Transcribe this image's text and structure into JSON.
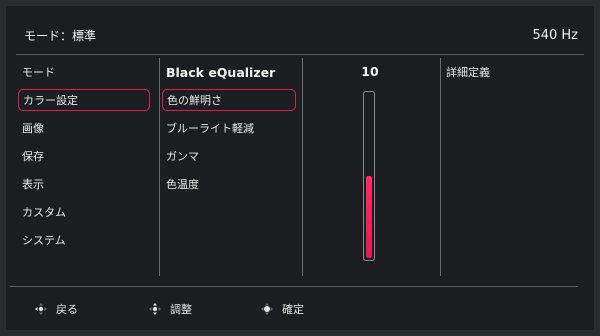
{
  "header": {
    "mode": "モード：標準",
    "refresh_rate": "540 Hz"
  },
  "menu": {
    "items": [
      {
        "label": "モード",
        "selected": false
      },
      {
        "label": "カラー設定",
        "selected": true
      },
      {
        "label": "画像",
        "selected": false
      },
      {
        "label": "保存",
        "selected": false
      },
      {
        "label": "表示",
        "selected": false
      },
      {
        "label": "カスタム",
        "selected": false
      },
      {
        "label": "システム",
        "selected": false
      }
    ]
  },
  "submenu": {
    "title": "Black eQualizer",
    "items": [
      {
        "label": "色の鮮明さ",
        "selected": true
      },
      {
        "label": "ブルーライト軽減",
        "selected": false
      },
      {
        "label": "ガンマ",
        "selected": false
      },
      {
        "label": "色温度",
        "selected": false
      }
    ]
  },
  "adjust": {
    "value": "10",
    "level_fraction": 0.5
  },
  "detail": {
    "label": "詳細定義"
  },
  "footer": {
    "back_label": "戻る",
    "adjust_label": "調整",
    "confirm_label": "確定"
  },
  "colors": {
    "accent": "#d8204e",
    "bar_fill": "#ff2a68",
    "panel": "#1c1d20"
  },
  "icons": {
    "back": "dpad-left-icon",
    "adjust": "dpad-updown-icon",
    "confirm": "dpad-press-icon"
  }
}
